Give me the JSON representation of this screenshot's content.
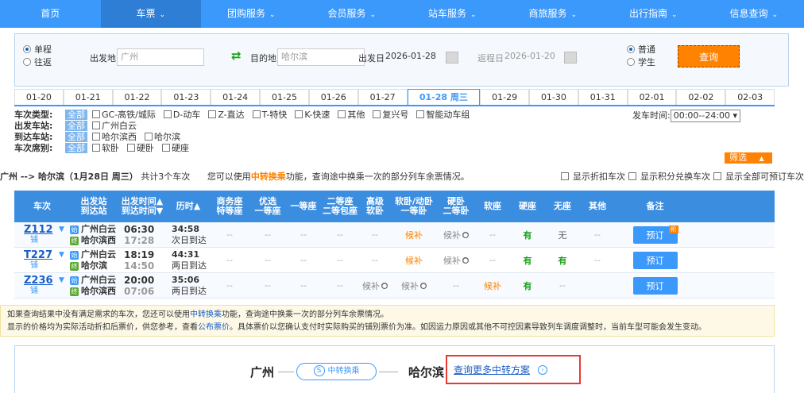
{
  "nav": [
    {
      "label": "首页",
      "caret": false,
      "active": false
    },
    {
      "label": "车票",
      "caret": true,
      "active": true
    },
    {
      "label": "团购服务",
      "caret": true,
      "active": false
    },
    {
      "label": "会员服务",
      "caret": true,
      "active": false
    },
    {
      "label": "站车服务",
      "caret": true,
      "active": false
    },
    {
      "label": "商旅服务",
      "caret": true,
      "active": false
    },
    {
      "label": "出行指南",
      "caret": true,
      "active": false
    },
    {
      "label": "信息查询",
      "caret": true,
      "active": false
    }
  ],
  "search": {
    "one_way": "单程",
    "round_trip": "往返",
    "from_label": "出发地",
    "from_value": "广州",
    "to_label": "目的地",
    "to_value": "哈尔滨",
    "depart_label": "出发日",
    "depart_value": "2026-01-28",
    "return_label": "返程日",
    "return_value": "2026-01-20",
    "normal": "普通",
    "student": "学生",
    "query_button": "查询"
  },
  "dates": [
    "01-20",
    "01-21",
    "01-22",
    "01-23",
    "01-24",
    "01-25",
    "01-26",
    "01-27",
    "01-28 周三",
    "01-29",
    "01-30",
    "01-31",
    "02-01",
    "02-02",
    "02-03"
  ],
  "active_date_index": 8,
  "filters": {
    "type_label": "车次类型:",
    "all": "全部",
    "types": [
      "GC-高铁/城际",
      "D-动车",
      "Z-直达",
      "T-特快",
      "K-快速",
      "其他",
      "复兴号",
      "智能动车组"
    ],
    "depart_time_label": "发车时间:",
    "depart_time_value": "00:00--24:00",
    "from_label": "出发车站:",
    "from_stations": [
      "广州白云"
    ],
    "to_label": "到达车站:",
    "to_stations": [
      "哈尔滨西",
      "哈尔滨"
    ],
    "seat_label": "车次席别:",
    "seats": [
      "软卧",
      "硬卧",
      "硬座"
    ],
    "filter_button": "筛选"
  },
  "summary": {
    "route": "广州 --> 哈尔滨（1月28日 周三）",
    "count": "共计3个车次",
    "hint_pre": "您可以使用",
    "hint_link": "中转换乘",
    "hint_post": "功能，查询途中换乘一次的部分列车余票情况。",
    "opt1": "显示折扣车次",
    "opt2": "显示积分兑换车次",
    "opt3": "显示全部可预订车次"
  },
  "headers": [
    "车次",
    "出发站|到达站",
    "出发时间▲|到达时间▼",
    "历时▲",
    "商务座|特等座",
    "优选|一等座",
    "一等座",
    "二等座|二等包座",
    "高级|软卧",
    "软卧/动卧|一等卧",
    "硬卧|二等卧",
    "软座",
    "硬座",
    "无座",
    "其他",
    "备注"
  ],
  "trains": [
    {
      "no": "Z112",
      "sub": "铺",
      "from": "广州白云",
      "to": "哈尔滨西",
      "dep": "06:30",
      "arr": "17:28",
      "dur": "34:58",
      "arrive_day": "次日到达",
      "seats": [
        "--",
        "--",
        "--",
        "--",
        "--",
        "候补",
        "候补",
        "--",
        "有",
        "无",
        "--"
      ],
      "book": "预订",
      "tag": "积"
    },
    {
      "no": "T227",
      "sub": "铺",
      "from": "广州白云",
      "to": "哈尔滨",
      "dep": "18:19",
      "arr": "14:50",
      "dur": "44:31",
      "arrive_day": "两日到达",
      "seats": [
        "--",
        "--",
        "--",
        "--",
        "--",
        "候补",
        "候补",
        "--",
        "有",
        "有",
        "--"
      ],
      "book": "预订",
      "tag": ""
    },
    {
      "no": "Z236",
      "sub": "铺",
      "from": "广州白云",
      "to": "哈尔滨西",
      "dep": "20:00",
      "arr": "07:06",
      "dur": "35:06",
      "arrive_day": "两日到达",
      "seats": [
        "--",
        "--",
        "--",
        "--",
        "候补",
        "候补",
        "--",
        "候补",
        "有",
        "--",
        ""
      ],
      "book": "预订",
      "tag": ""
    }
  ],
  "notice": {
    "line1_pre": "如果查询结果中没有满足需求的车次，您还可以使用",
    "line1_link": "中转换乘",
    "line1_post": "功能，查询途中换乘一次的部分列车余票情况。",
    "line2_pre": "显示的价格均为实际活动折扣后票价，供您参考，查看",
    "line2_link": "公布票价",
    "line2_post": "。具体票价以您确认支付时实际购买的铺别票价为准。如因运力原因或其他不可控因素导致列车调度调整时，当前车型可能会发生变动。"
  },
  "transfer": {
    "from": "广州",
    "mid": "中转换乘",
    "to": "哈尔滨",
    "more": "查询更多中转方案"
  }
}
